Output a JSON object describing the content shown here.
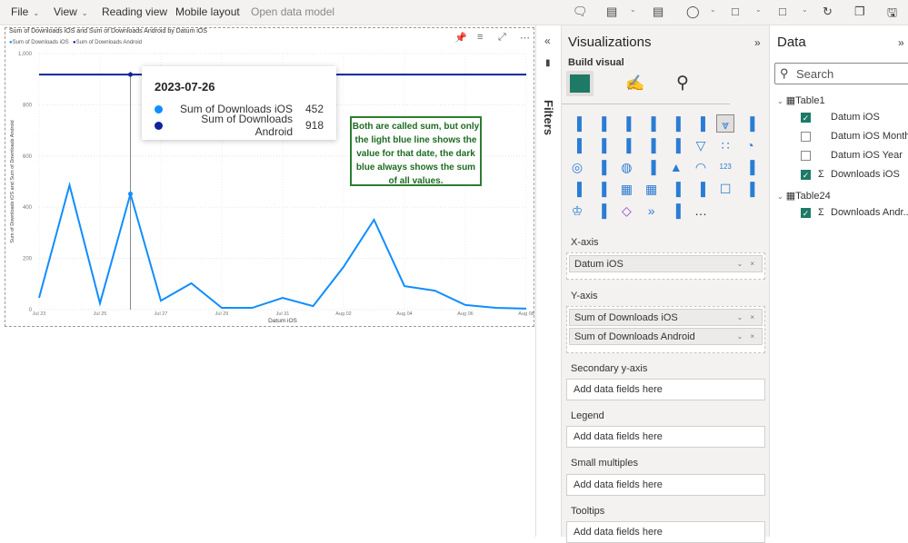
{
  "menu": {
    "file": "File",
    "view": "View",
    "reading_view": "Reading view",
    "mobile_layout": "Mobile layout",
    "open_data_model": "Open data model"
  },
  "toolbar_icons": [
    "comment-icon",
    "copilot-icon",
    "notes-icon",
    "shapes-icon",
    "visual-icon",
    "page-icon",
    "refresh-icon",
    "copy-icon",
    "save-icon"
  ],
  "visual": {
    "title": "Sum of Downloads iOS and Sum of Downloads Android by Datum iOS",
    "tooltip": {
      "date": "2023-07-26",
      "rows": [
        {
          "label": "Sum of Downloads iOS",
          "value": "452",
          "color": "#118dff"
        },
        {
          "label": "Sum of Downloads Android",
          "value": "918",
          "color": "#12239e"
        }
      ]
    },
    "note": "Both are called sum, but only the light blue line shows the value for that date, the dark blue always shows the sum of all values."
  },
  "chart_data": {
    "type": "line",
    "title": "Sum of Downloads iOS and Sum of Downloads Android by Datum iOS",
    "xlabel": "Datum iOS",
    "ylabel": "Sum of Downloads iOS and Sum of Downloads Android",
    "x": [
      "2023-07-23",
      "2023-07-24",
      "2023-07-25",
      "2023-07-26",
      "2023-07-27",
      "2023-07-28",
      "2023-07-29",
      "2023-07-30",
      "2023-07-31",
      "2023-08-01",
      "2023-08-02",
      "2023-08-03",
      "2023-08-04",
      "2023-08-05",
      "2023-08-06",
      "2023-08-07",
      "2023-08-08"
    ],
    "x_ticks": [
      "Jul 23",
      "Jul 25",
      "Jul 27",
      "Jul 29",
      "Jul 31",
      "Aug 02",
      "Aug 04",
      "Aug 06",
      "Aug 08"
    ],
    "y_ticks": [
      "0",
      "200",
      "400",
      "600",
      "800",
      "1,000"
    ],
    "ylim": [
      0,
      1000
    ],
    "grid": true,
    "legend_position": "top-left",
    "series": [
      {
        "name": "Sum of Downloads iOS",
        "color": "#118dff",
        "values": [
          46,
          486,
          25,
          452,
          35,
          103,
          7,
          7,
          46,
          14,
          167,
          351,
          92,
          74,
          18,
          7,
          4
        ]
      },
      {
        "name": "Sum of Downloads Android",
        "color": "#12239e",
        "values": [
          918,
          918,
          918,
          918,
          918,
          918,
          918,
          918,
          918,
          918,
          918,
          918,
          918,
          918,
          918,
          918,
          918
        ]
      }
    ]
  },
  "filters": {
    "label": "Filters"
  },
  "visualizations": {
    "title": "Visualizations",
    "build_visual": "Build visual",
    "icons": [
      "stacked-bar-icon",
      "stacked-column-icon",
      "clustered-bar-icon",
      "clustered-column-icon",
      "100-bar-icon",
      "100-column-icon",
      "line-chart-icon",
      "area-chart-icon",
      "stacked-area-icon",
      "line-stacked-column-icon",
      "line-clustered-column-icon",
      "ribbon-icon",
      "waterfall-icon",
      "funnel-icon",
      "scatter-icon",
      "pie-icon",
      "donut-icon",
      "treemap-icon",
      "map-icon",
      "filled-map-icon",
      "azure-map-icon",
      "gauge-icon",
      "card-icon",
      "multirow-card-icon",
      "kpi-icon",
      "slicer-icon",
      "table-icon",
      "matrix-icon",
      "decomposition-tree-icon",
      "key-influencers-icon",
      "qa-icon",
      "narrative-icon",
      "trophy-icon",
      "paginated-report-icon",
      "power-apps-icon",
      "power-automate-icon",
      "python-icon",
      "more-icon"
    ],
    "x_axis": {
      "label": "X-axis",
      "fields": [
        "Datum iOS"
      ]
    },
    "y_axis": {
      "label": "Y-axis",
      "fields": [
        "Sum of Downloads iOS",
        "Sum of Downloads Android"
      ]
    },
    "secondary": {
      "label": "Secondary y-axis",
      "placeholder": "Add data fields here"
    },
    "legend": {
      "label": "Legend",
      "placeholder": "Add data fields here"
    },
    "small_multiples": {
      "label": "Small multiples",
      "placeholder": "Add data fields here"
    },
    "tooltips": {
      "label": "Tooltips",
      "placeholder": "Add data fields here"
    }
  },
  "data": {
    "title": "Data",
    "search_placeholder": "Search",
    "tables": [
      {
        "name": "Table1",
        "fields": [
          {
            "name": "Datum iOS",
            "checked": true,
            "sigma": false
          },
          {
            "name": "Datum iOS Month",
            "checked": false,
            "sigma": false
          },
          {
            "name": "Datum iOS Year",
            "checked": false,
            "sigma": false
          },
          {
            "name": "Downloads iOS",
            "checked": true,
            "sigma": true
          }
        ]
      },
      {
        "name": "Table24",
        "fields": [
          {
            "name": "Downloads Andr...",
            "checked": true,
            "sigma": true
          }
        ]
      }
    ]
  }
}
